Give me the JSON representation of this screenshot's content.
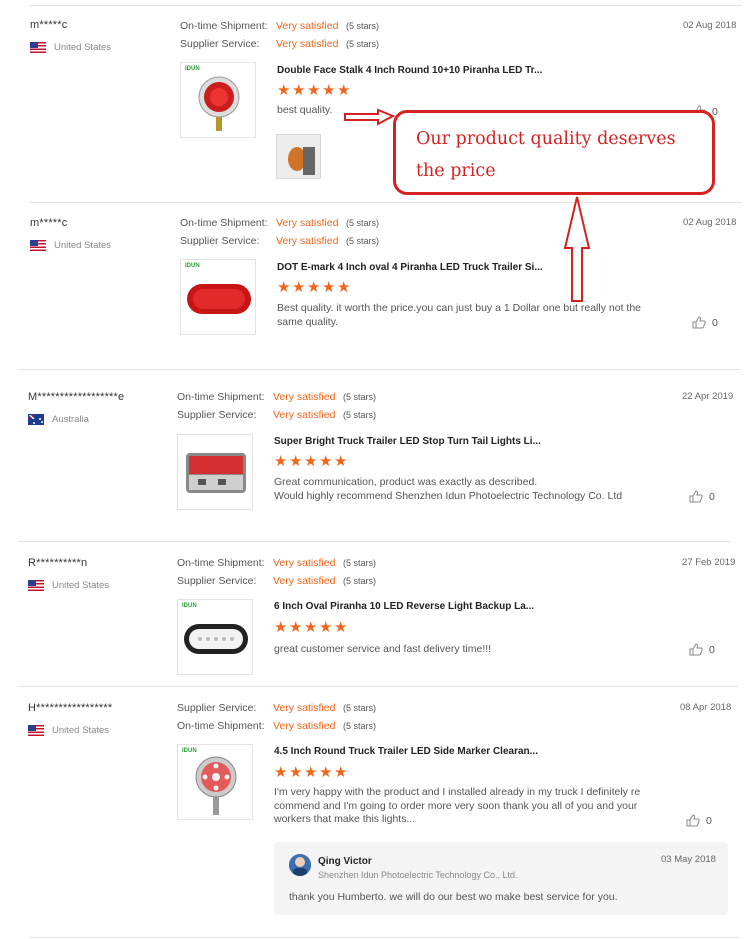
{
  "reviews": [
    {
      "user": "m*****c",
      "country": "United States",
      "flag": "us",
      "ratings": [
        {
          "label": "On-time Shipment:",
          "value": "Very satisfied",
          "stars": "(5 stars)"
        },
        {
          "label": "Supplier Service:",
          "value": "Very satisfied",
          "stars": "(5 stars)"
        }
      ],
      "date": "02 Aug 2018",
      "product_title": "Double Face Stalk 4 Inch Round 10+10 Piranha LED Tr...",
      "stars": 5,
      "text_lines": [
        "best quality."
      ],
      "likes": "0",
      "thumb_logo": "IDUN"
    },
    {
      "user": "m*****c",
      "country": "United States",
      "flag": "us",
      "ratings": [
        {
          "label": "On-time Shipment:",
          "value": "Very satisfied",
          "stars": "(5 stars)"
        },
        {
          "label": "Supplier Service:",
          "value": "Very satisfied",
          "stars": "(5 stars)"
        }
      ],
      "date": "02 Aug 2018",
      "product_title": "DOT E-mark 4 Inch oval 4 Piranha LED Truck Trailer Si...",
      "stars": 5,
      "text_lines": [
        "Best quality. it worth the price.you can just buy a 1 Dollar one but really not the",
        "same quality."
      ],
      "likes": "0",
      "thumb_logo": "IDUN"
    },
    {
      "user": "M******************e",
      "country": "Australia",
      "flag": "au",
      "ratings": [
        {
          "label": "On-time Shipment:",
          "value": "Very satisfied",
          "stars": "(5 stars)"
        },
        {
          "label": "Supplier Service:",
          "value": "Very satisfied",
          "stars": "(5 stars)"
        }
      ],
      "date": "22 Apr 2019",
      "product_title": "Super Bright Truck Trailer LED Stop Turn Tail Lights Li...",
      "stars": 5,
      "text_lines": [
        "Great communication, product was exactly as described.",
        "Would highly recommend Shenzhen Idun Photoelectric Technology Co. Ltd"
      ],
      "likes": "0",
      "thumb_logo": ""
    },
    {
      "user": "R**********n",
      "country": "United States",
      "flag": "us",
      "ratings": [
        {
          "label": "On-time Shipment:",
          "value": "Very satisfied",
          "stars": "(5 stars)"
        },
        {
          "label": "Supplier Service:",
          "value": "Very satisfied",
          "stars": "(5 stars)"
        }
      ],
      "date": "27 Feb 2019",
      "product_title": "6 Inch Oval Piranha 10 LED Reverse Light Backup La...",
      "stars": 5,
      "text_lines": [
        "great customer service and fast delivery time!!!"
      ],
      "likes": "0",
      "thumb_logo": "IDUN"
    },
    {
      "user": "H*****************",
      "country": "United States",
      "flag": "us",
      "ratings": [
        {
          "label": "Supplier Service:",
          "value": "Very satisfied",
          "stars": "(5 stars)"
        },
        {
          "label": "On-time Shipment:",
          "value": "Very satisfied",
          "stars": "(5 stars)"
        }
      ],
      "date": "08 Apr 2018",
      "product_title": "4.5 Inch Round Truck Trailer LED Side Marker Clearan...",
      "stars": 5,
      "text_lines": [
        "I'm very happy with the product and I installed already in my truck I definitely re",
        "commend and I'm going to order more very soon thank you all of you and your",
        "workers that make this lights..."
      ],
      "likes": "0",
      "thumb_logo": "IDUN"
    }
  ],
  "reply": {
    "name": "Qing Victor",
    "company": "Shenzhen Idun Photoelectric Technology Co., Ltd.",
    "date": "03 May 2018",
    "text": "thank you Humberto. we will do our best wo make best service for you."
  },
  "annotation": {
    "text_line1": "Our product quality deserves",
    "text_line2": "the price",
    "color": "#d42222"
  },
  "colors": {
    "accent": "#f0661c",
    "star": "#f0661c"
  }
}
